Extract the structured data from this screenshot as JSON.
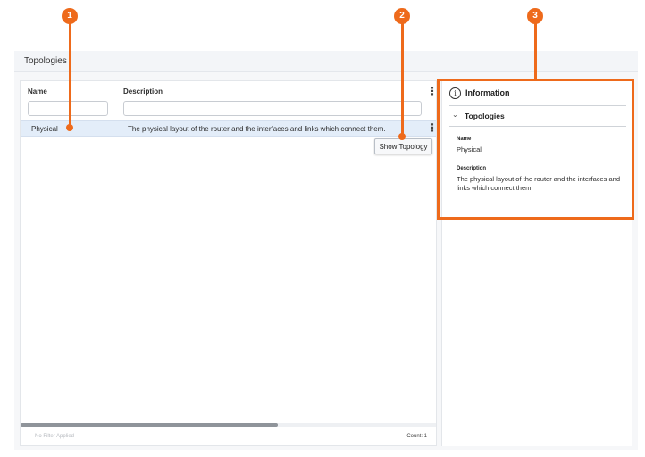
{
  "page": {
    "title": "Topologies"
  },
  "grid": {
    "columns": [
      {
        "label": "Name"
      },
      {
        "label": "Description"
      }
    ],
    "filters": {
      "name_value": "",
      "description_value": ""
    },
    "rows": [
      {
        "name": "Physical",
        "description": "The physical layout of the router and the interfaces and links which connect them."
      }
    ],
    "context_menu": {
      "show_topology_label": "Show Topology"
    },
    "scroll_position_fraction": 0.62,
    "footer": {
      "filter_status": "No Filter Applied",
      "count": "Count: 1"
    }
  },
  "info_panel": {
    "icon": "info-circle-icon",
    "title": "Information",
    "section": {
      "icon": "chevron-down-icon",
      "title": "Topologies"
    },
    "fields": [
      {
        "label": "Name",
        "value": "Physical"
      },
      {
        "label": "Description",
        "value": "The physical layout of the router and the interfaces and links which connect them."
      }
    ]
  },
  "callouts": [
    "1",
    "2",
    "3"
  ],
  "colors": {
    "accent": "#ee6a1b",
    "selected_row": "#e3edf9"
  }
}
